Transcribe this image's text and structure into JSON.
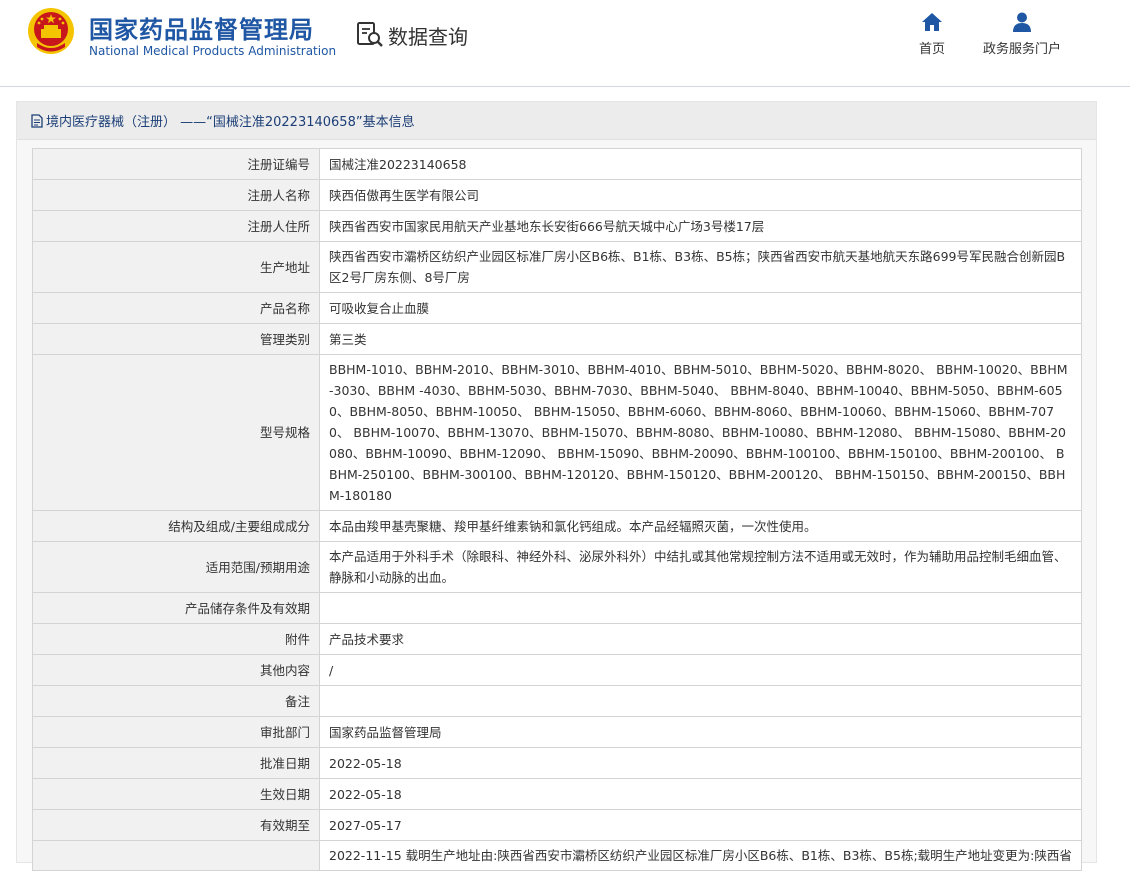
{
  "header": {
    "site_name_cn": "国家药品监督管理局",
    "site_name_en": "National Medical Products Administration",
    "query_label": "数据查询",
    "nav": [
      {
        "label": "首页",
        "icon": "home-icon"
      },
      {
        "label": "政务服务门户",
        "icon": "user-icon"
      }
    ]
  },
  "panel": {
    "title": "境内医疗器械（注册） ——“国械注准20223140658”基本信息"
  },
  "rows": [
    {
      "key": "注册证编号",
      "value": "国械注准20223140658"
    },
    {
      "key": "注册人名称",
      "value": "陕西佰傲再生医学有限公司"
    },
    {
      "key": "注册人住所",
      "value": "陕西省西安市国家民用航天产业基地东长安街666号航天城中心广场3号楼17层"
    },
    {
      "key": "生产地址",
      "value": "陕西省西安市灞桥区纺织产业园区标准厂房小区B6栋、B1栋、B3栋、B5栋；陕西省西安市航天基地航天东路699号军民融合创新园B区2号厂房东侧、8号厂房"
    },
    {
      "key": "产品名称",
      "value": "可吸收复合止血膜"
    },
    {
      "key": "管理类别",
      "value": "第三类"
    },
    {
      "key": "型号规格",
      "value": "BBHM-1010、BBHM-2010、BBHM-3010、BBHM-4010、BBHM-5010、BBHM-5020、BBHM-8020、 BBHM-10020、BBHM-3030、BBHM -4030、BBHM-5030、BBHM-7030、BBHM-5040、 BBHM-8040、BBHM-10040、BBHM-5050、BBHM-6050、BBHM-8050、BBHM-10050、 BBHM-15050、BBHM-6060、BBHM-8060、BBHM-10060、BBHM-15060、BBHM-7070、 BBHM-10070、BBHM-13070、BBHM-15070、BBHM-8080、BBHM-10080、BBHM-12080、 BBHM-15080、BBHM-20080、BBHM-10090、BBHM-12090、 BBHM-15090、BBHM-20090、BBHM-100100、BBHM-150100、BBHM-200100、 BBHM-250100、BBHM-300100、BBHM-120120、BBHM-150120、BBHM-200120、 BBHM-150150、BBHM-200150、BBHM-180180"
    },
    {
      "key": "结构及组成/主要组成成分",
      "value": "本品由羧甲基壳聚糖、羧甲基纤维素钠和氯化钙组成。本产品经辐照灭菌，一次性使用。"
    },
    {
      "key": "适用范围/预期用途",
      "value": "本产品适用于外科手术（除眼科、神经外科、泌尿外科外）中结扎或其他常规控制方法不适用或无效时，作为辅助用品控制毛细血管、静脉和小动脉的出血。"
    },
    {
      "key": "产品储存条件及有效期",
      "value": ""
    },
    {
      "key": "附件",
      "value": "产品技术要求"
    },
    {
      "key": "其他内容",
      "value": "/"
    },
    {
      "key": "备注",
      "value": ""
    },
    {
      "key": "审批部门",
      "value": "国家药品监督管理局"
    },
    {
      "key": "批准日期",
      "value": "2022-05-18"
    },
    {
      "key": "生效日期",
      "value": "2022-05-18"
    },
    {
      "key": "有效期至",
      "value": "2027-05-17"
    },
    {
      "key": "",
      "value": "2022-11-15 载明生产地址由:陕西省西安市灞桥区纺织产业园区标准厂房小区B6栋、B1栋、B3栋、B5栋;载明生产地址变更为:陕西省"
    }
  ],
  "colors": {
    "brand_blue": "#1f57a4",
    "title_blue": "#1c3f77",
    "emblem_red": "#c8161d",
    "emblem_gold": "#f5c400"
  }
}
